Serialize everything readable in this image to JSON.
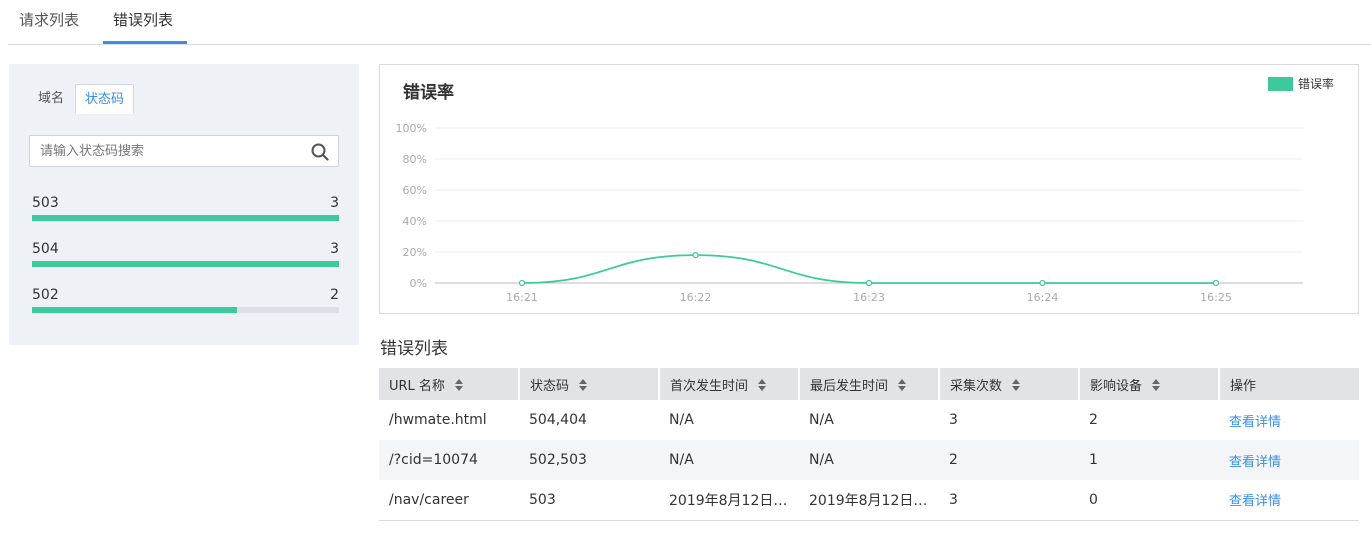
{
  "tabs": {
    "items": [
      {
        "label": "请求列表"
      },
      {
        "label": "错误列表"
      }
    ],
    "active": 1
  },
  "filter": {
    "tabs": [
      {
        "label": "域名"
      },
      {
        "label": "状态码"
      }
    ],
    "search_placeholder": "请输入状态码搜索",
    "codes": [
      {
        "code": "503",
        "count": "3",
        "ratio": 1.0
      },
      {
        "code": "504",
        "count": "3",
        "ratio": 1.0
      },
      {
        "code": "502",
        "count": "2",
        "ratio": 0.667
      }
    ]
  },
  "colors": {
    "accent": "#3cc99b",
    "link": "#3a8ee6"
  },
  "chart_data": {
    "type": "line",
    "title": "错误率",
    "categories": [
      "16:21",
      "16:22",
      "16:23",
      "16:24",
      "16:25"
    ],
    "series": [
      {
        "name": "错误率",
        "values": [
          0,
          18,
          0,
          0,
          0
        ]
      }
    ],
    "y_ticks": [
      "0%",
      "20%",
      "40%",
      "60%",
      "80%",
      "100%"
    ],
    "ylim": [
      0,
      100
    ],
    "legend_position": "top-right",
    "grid": true
  },
  "list": {
    "title": "错误列表",
    "columns": [
      "URL 名称",
      "状态码",
      "首次发生时间",
      "最后发生时间",
      "采集次数",
      "影响设备",
      "操作"
    ],
    "rows": [
      {
        "url": "/hwmate.html",
        "status": "504,404",
        "first": "N/A",
        "last": "N/A",
        "collect": "3",
        "devices": "2",
        "action": "查看详情"
      },
      {
        "url": "/?cid=10074",
        "status": "502,503",
        "first": "N/A",
        "last": "N/A",
        "collect": "2",
        "devices": "1",
        "action": "查看详情"
      },
      {
        "url": "/nav/career",
        "status": "503",
        "first": "2019年8月12日…",
        "last": "2019年8月12日…",
        "collect": "3",
        "devices": "0",
        "action": "查看详情"
      }
    ]
  }
}
